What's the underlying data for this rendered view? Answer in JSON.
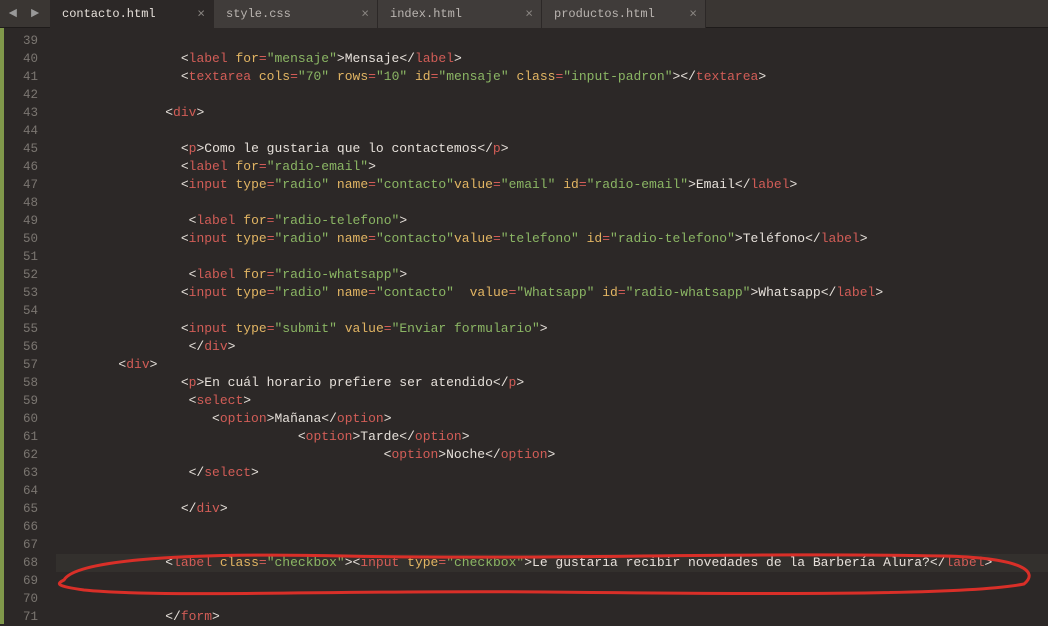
{
  "tabs": [
    {
      "name": "contacto.html",
      "active": true
    },
    {
      "name": "style.css",
      "active": false
    },
    {
      "name": "index.html",
      "active": false
    },
    {
      "name": "productos.html",
      "active": false
    }
  ],
  "lineStart": 39,
  "lineEnd": 71,
  "currentLine": 68,
  "code": {
    "l39": "",
    "l40": {
      "indent": "                ",
      "parts": [
        "<",
        "label",
        " ",
        "for",
        "=",
        "\"mensaje\"",
        ">",
        "Mensaje",
        "</",
        "label",
        ">"
      ]
    },
    "l41": {
      "indent": "                ",
      "parts": [
        "<",
        "textarea",
        " ",
        "cols",
        "=",
        "\"70\"",
        " ",
        "rows",
        "=",
        "\"10\"",
        " ",
        "id",
        "=",
        "\"mensaje\"",
        " ",
        "class",
        "=",
        "\"input-padron\"",
        ">",
        "",
        "</",
        "textarea",
        ">"
      ]
    },
    "l42": "",
    "l43": {
      "indent": "              ",
      "parts": [
        "<",
        "div",
        ">"
      ]
    },
    "l44": "",
    "l45": {
      "indent": "                ",
      "parts": [
        "<",
        "p",
        ">",
        "Como le gustaria que lo contactemos",
        "</",
        "p",
        ">"
      ]
    },
    "l46": {
      "indent": "                ",
      "parts": [
        "<",
        "label",
        " ",
        "for",
        "=",
        "\"radio-email\"",
        ">"
      ]
    },
    "l47": {
      "indent": "                ",
      "parts": [
        "<",
        "input",
        " ",
        "type",
        "=",
        "\"radio\"",
        " ",
        "name",
        "=",
        "\"contacto\"",
        "value",
        "=",
        "\"email\"",
        " ",
        "id",
        "=",
        "\"radio-email\"",
        ">",
        "Email",
        "</",
        "label",
        ">"
      ]
    },
    "l48": "",
    "l49": {
      "indent": "                 ",
      "parts": [
        "<",
        "label",
        " ",
        "for",
        "=",
        "\"radio-telefono\"",
        ">"
      ]
    },
    "l50": {
      "indent": "                ",
      "parts": [
        "<",
        "input",
        " ",
        "type",
        "=",
        "\"radio\"",
        " ",
        "name",
        "=",
        "\"contacto\"",
        "value",
        "=",
        "\"telefono\"",
        " ",
        "id",
        "=",
        "\"radio-telefono\"",
        ">",
        "Teléfono",
        "</",
        "label",
        ">"
      ]
    },
    "l51": "",
    "l52": {
      "indent": "                 ",
      "parts": [
        "<",
        "label",
        " ",
        "for",
        "=",
        "\"radio-whatsapp\"",
        ">"
      ]
    },
    "l53": {
      "indent": "                ",
      "parts": [
        "<",
        "input",
        " ",
        "type",
        "=",
        "\"radio\"",
        " ",
        "name",
        "=",
        "\"contacto\"",
        "  ",
        "value",
        "=",
        "\"Whatsapp\"",
        " ",
        "id",
        "=",
        "\"radio-whatsapp\"",
        ">",
        "Whatsapp",
        "</",
        "label",
        ">"
      ]
    },
    "l54": "",
    "l55": {
      "indent": "                ",
      "parts": [
        "<",
        "input",
        " ",
        "type",
        "=",
        "\"submit\"",
        " ",
        "value",
        "=",
        "\"Enviar formulario\"",
        ">"
      ]
    },
    "l56": {
      "indent": "                 ",
      "parts": [
        "</",
        "div",
        ">"
      ]
    },
    "l57": {
      "indent": "        ",
      "parts": [
        "<",
        "div",
        ">"
      ]
    },
    "l58": {
      "indent": "                ",
      "parts": [
        "<",
        "p",
        ">",
        "En cuál horario prefiere ser atendido",
        "</",
        "p",
        ">"
      ]
    },
    "l59": {
      "indent": "                 ",
      "parts": [
        "<",
        "select",
        ">"
      ]
    },
    "l60": {
      "indent": "                    ",
      "parts": [
        "<",
        "option",
        ">",
        "Mañana",
        "</",
        "option",
        ">"
      ]
    },
    "l61": {
      "indent": "                               ",
      "parts": [
        "<",
        "option",
        ">",
        "Tarde",
        "</",
        "option",
        ">"
      ]
    },
    "l62": {
      "indent": "                                          ",
      "parts": [
        "<",
        "option",
        ">",
        "Noche",
        "</",
        "option",
        ">"
      ]
    },
    "l63": {
      "indent": "                 ",
      "parts": [
        "</",
        "select",
        ">"
      ]
    },
    "l64": "",
    "l65": {
      "indent": "                ",
      "parts": [
        "</",
        "div",
        ">"
      ]
    },
    "l66": "",
    "l67": "",
    "l68": {
      "indent": "              ",
      "parts": [
        "<",
        "label",
        " ",
        "class",
        "=",
        "\"checkbox\"",
        ">",
        "",
        "<",
        "input",
        " ",
        "type",
        "=",
        "\"checkbox\"",
        ">",
        "Le gustaría recibir novedades de la Barbería Alura?",
        "</",
        "label",
        ">"
      ]
    },
    "l69": "",
    "l70": "",
    "l71": {
      "indent": "              ",
      "parts": [
        "</",
        "form",
        ">"
      ]
    }
  }
}
